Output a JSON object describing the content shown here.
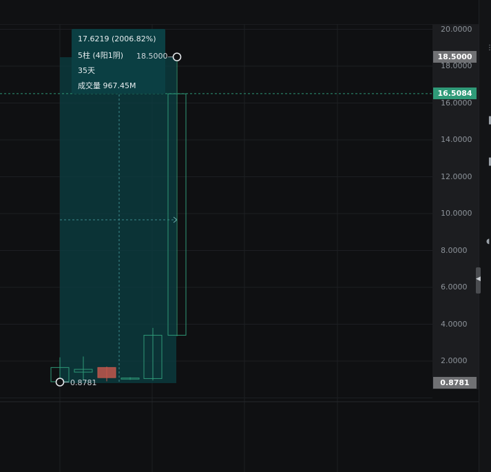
{
  "chart_data": {
    "type": "candlestick",
    "ylim": [
      0,
      20
    ],
    "y_ticks": [
      "20.0000",
      "18.0000",
      "16.0000",
      "14.0000",
      "12.0000",
      "10.0000",
      "8.0000",
      "6.0000",
      "4.0000",
      "2.0000"
    ],
    "candles": [
      {
        "open": 0.88,
        "close": 1.65,
        "high": 2.2,
        "low": 0.88
      },
      {
        "open": 1.4,
        "close": 1.55,
        "high": 2.25,
        "low": 0.95
      },
      {
        "open": 1.65,
        "close": 1.1,
        "high": 1.7,
        "low": 0.9
      },
      {
        "open": 1.02,
        "close": 1.08,
        "high": 1.12,
        "low": 0.98
      },
      {
        "open": 1.05,
        "close": 3.4,
        "high": 3.8,
        "low": 0.95
      },
      {
        "open": 3.4,
        "close": 16.5,
        "high": 18.5,
        "low": 3.35
      }
    ],
    "current_price": 16.5084,
    "high_price": 18.5,
    "low_price": 0.8781,
    "colors": {
      "up": "#2f9a78",
      "down": "#c0574c",
      "measure_fill": "#0b3f43"
    }
  },
  "measure_info": {
    "change": "17.6219 (2006.82%)",
    "bars": "5柱 (4阳1阴)",
    "days": "35天",
    "volume": "成交量 967.45M"
  },
  "price_tags": {
    "high": "18.5000",
    "current": "16.5084",
    "low": "0.8781"
  },
  "point_labels": {
    "high": "18.5000",
    "low": "0.8781"
  },
  "right_panel": {
    "icons": [
      "more-icon",
      "side-icon-a",
      "side-icon-b",
      "side-icon-c"
    ]
  }
}
